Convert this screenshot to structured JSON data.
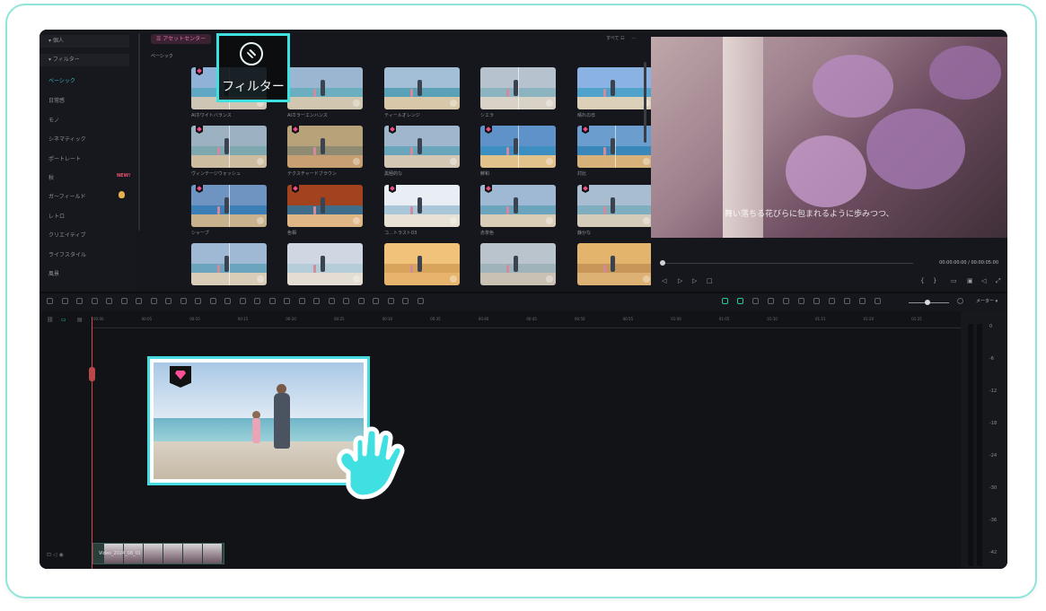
{
  "sidebar": {
    "items": [
      {
        "label": "▾ 個人"
      },
      {
        "label": "▾ フィルター"
      },
      {
        "label": "ベーシック"
      },
      {
        "label": "日常感"
      },
      {
        "label": "モノ"
      },
      {
        "label": "シネマティック"
      },
      {
        "label": "ポートレート"
      },
      {
        "label": "秋",
        "badge": "NEW!"
      },
      {
        "label": "ガーフィールド"
      },
      {
        "label": "レトロ"
      },
      {
        "label": "クリエイティブ"
      },
      {
        "label": "ライフスタイル"
      },
      {
        "label": "風景"
      }
    ]
  },
  "assets": {
    "asset_center_label": "☰ アセットセンター",
    "category_label": "ベーシック",
    "filter_all_label": "すべて ☷",
    "more_label": "···",
    "thumbs": [
      {
        "label": "AIホワイトバランス"
      },
      {
        "label": "AIカラーエンハンス"
      },
      {
        "label": "ティールオレンジ"
      },
      {
        "label": "シエラ"
      },
      {
        "label": "晴れの日"
      },
      {
        "label": "ヴィンテージウォッシュ"
      },
      {
        "label": "テクスチャードブラウン"
      },
      {
        "label": "黒極的な"
      },
      {
        "label": "鮮和"
      },
      {
        "label": "対比"
      },
      {
        "label": "シャープ"
      },
      {
        "label": "色相"
      },
      {
        "label": "コ…トラスト03"
      },
      {
        "label": "赤茶色"
      },
      {
        "label": "静かな"
      },
      {
        "label": ""
      },
      {
        "label": ""
      },
      {
        "label": ""
      },
      {
        "label": ""
      },
      {
        "label": ""
      }
    ]
  },
  "preview": {
    "subtitle": "舞い落ちる花びらに包まれるように歩みつつ、",
    "time_current": "00:00:00:00",
    "time_total": "/ 00:00:05:00"
  },
  "toolbar": {
    "meter_label": "メーター ▾"
  },
  "timeline": {
    "ticks": [
      "00:00",
      "00:05",
      "00:10",
      "00:15",
      "00:20",
      "00:25",
      "00:30",
      "00:35",
      "00:40",
      "00:45",
      "00:50",
      "00:55",
      "01:00",
      "01:05",
      "01:10",
      "01:15",
      "01:20",
      "01:25"
    ],
    "clip_name": "Video_2024_08_01"
  },
  "audio_meter": {
    "labels": [
      "0",
      "-6",
      "-12",
      "-18",
      "-24",
      "-30",
      "-36",
      "-42"
    ]
  },
  "callout": {
    "label": "フィルター"
  },
  "colors": {
    "accent": "#3fe0e0",
    "premium": "#ff4f97",
    "app_bg": "#15171c"
  }
}
